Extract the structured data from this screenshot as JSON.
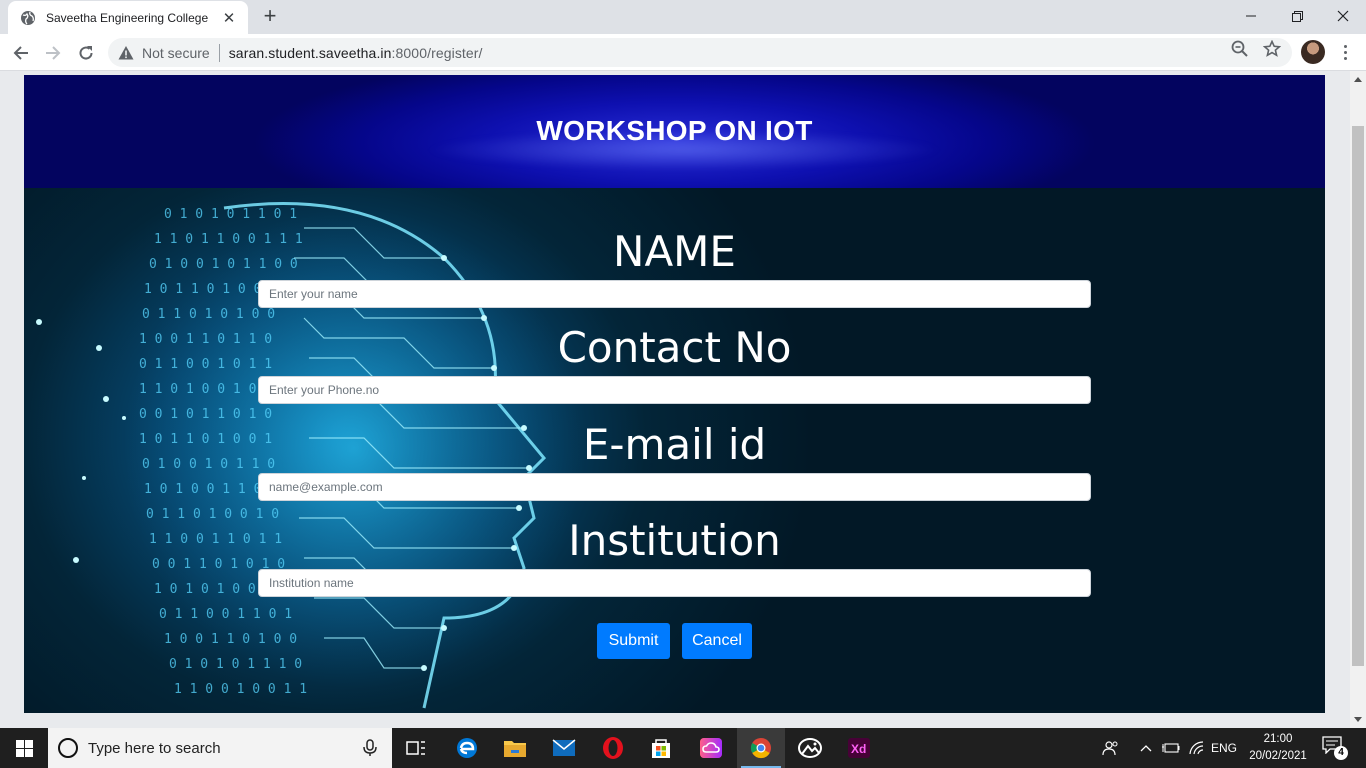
{
  "browser": {
    "tab_title": "Saveetha Engineering College",
    "security_label": "Not secure",
    "url_host": "saran.student.saveetha.in",
    "url_rest": ":8000/register/"
  },
  "page": {
    "banner_title": "WORKSHOP ON IOT",
    "fields": [
      {
        "label": "NAME",
        "placeholder": "Enter your name"
      },
      {
        "label": "Contact No",
        "placeholder": "Enter your Phone.no"
      },
      {
        "label": "E-mail id",
        "placeholder": "name@example.com"
      },
      {
        "label": "Institution",
        "placeholder": "Institution name"
      }
    ],
    "submit_label": "Submit",
    "cancel_label": "Cancel",
    "colors": {
      "button": "#007bff",
      "banner": "#0e10b0"
    }
  },
  "taskbar": {
    "search_placeholder": "Type here to search",
    "language": "ENG",
    "time": "21:00",
    "date": "20/02/2021",
    "notification_count": "4",
    "apps": [
      "task-view",
      "edge",
      "file-explorer",
      "mail",
      "opera",
      "store",
      "creative-cloud",
      "chrome",
      "photos",
      "adobe-xd"
    ]
  }
}
